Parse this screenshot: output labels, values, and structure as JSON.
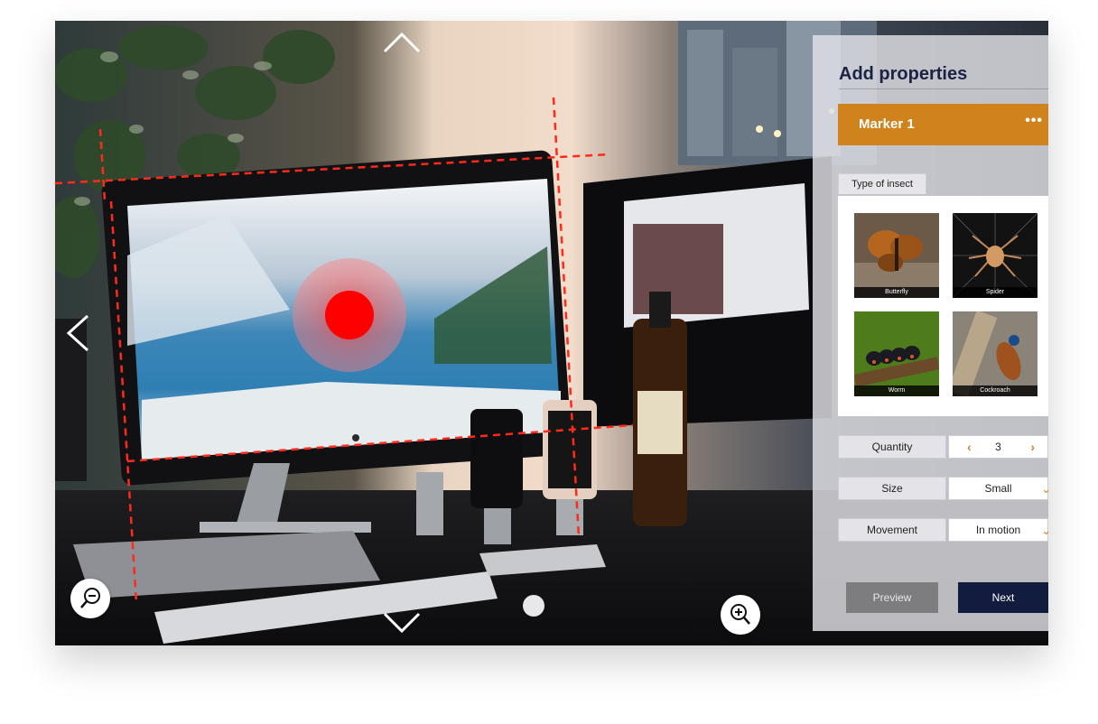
{
  "panel": {
    "title": "Add properties",
    "marker": {
      "label": "Marker 1",
      "more_label": "•••"
    },
    "section_label": "Type of insect",
    "insects": [
      {
        "label": "Butterfly"
      },
      {
        "label": "Spider"
      },
      {
        "label": "Worm"
      },
      {
        "label": "Cockroach"
      }
    ],
    "fields": {
      "quantity": {
        "label": "Quantity",
        "value": "3",
        "decrement": "‹",
        "increment": "›"
      },
      "size": {
        "label": "Size",
        "value": "Small"
      },
      "movement": {
        "label": "Movement",
        "value": "In motion"
      }
    },
    "buttons": {
      "preview": "Preview",
      "next": "Next"
    }
  },
  "colors": {
    "accent": "#d0831c",
    "primary": "#121c3f",
    "marker": "#ff0000",
    "guide": "#ff2a1a"
  },
  "icons": [
    "chevron-up-icon",
    "chevron-down-icon",
    "chevron-left-icon",
    "zoom-out-icon",
    "zoom-in-icon",
    "more-icon",
    "chevron-down-icon"
  ]
}
